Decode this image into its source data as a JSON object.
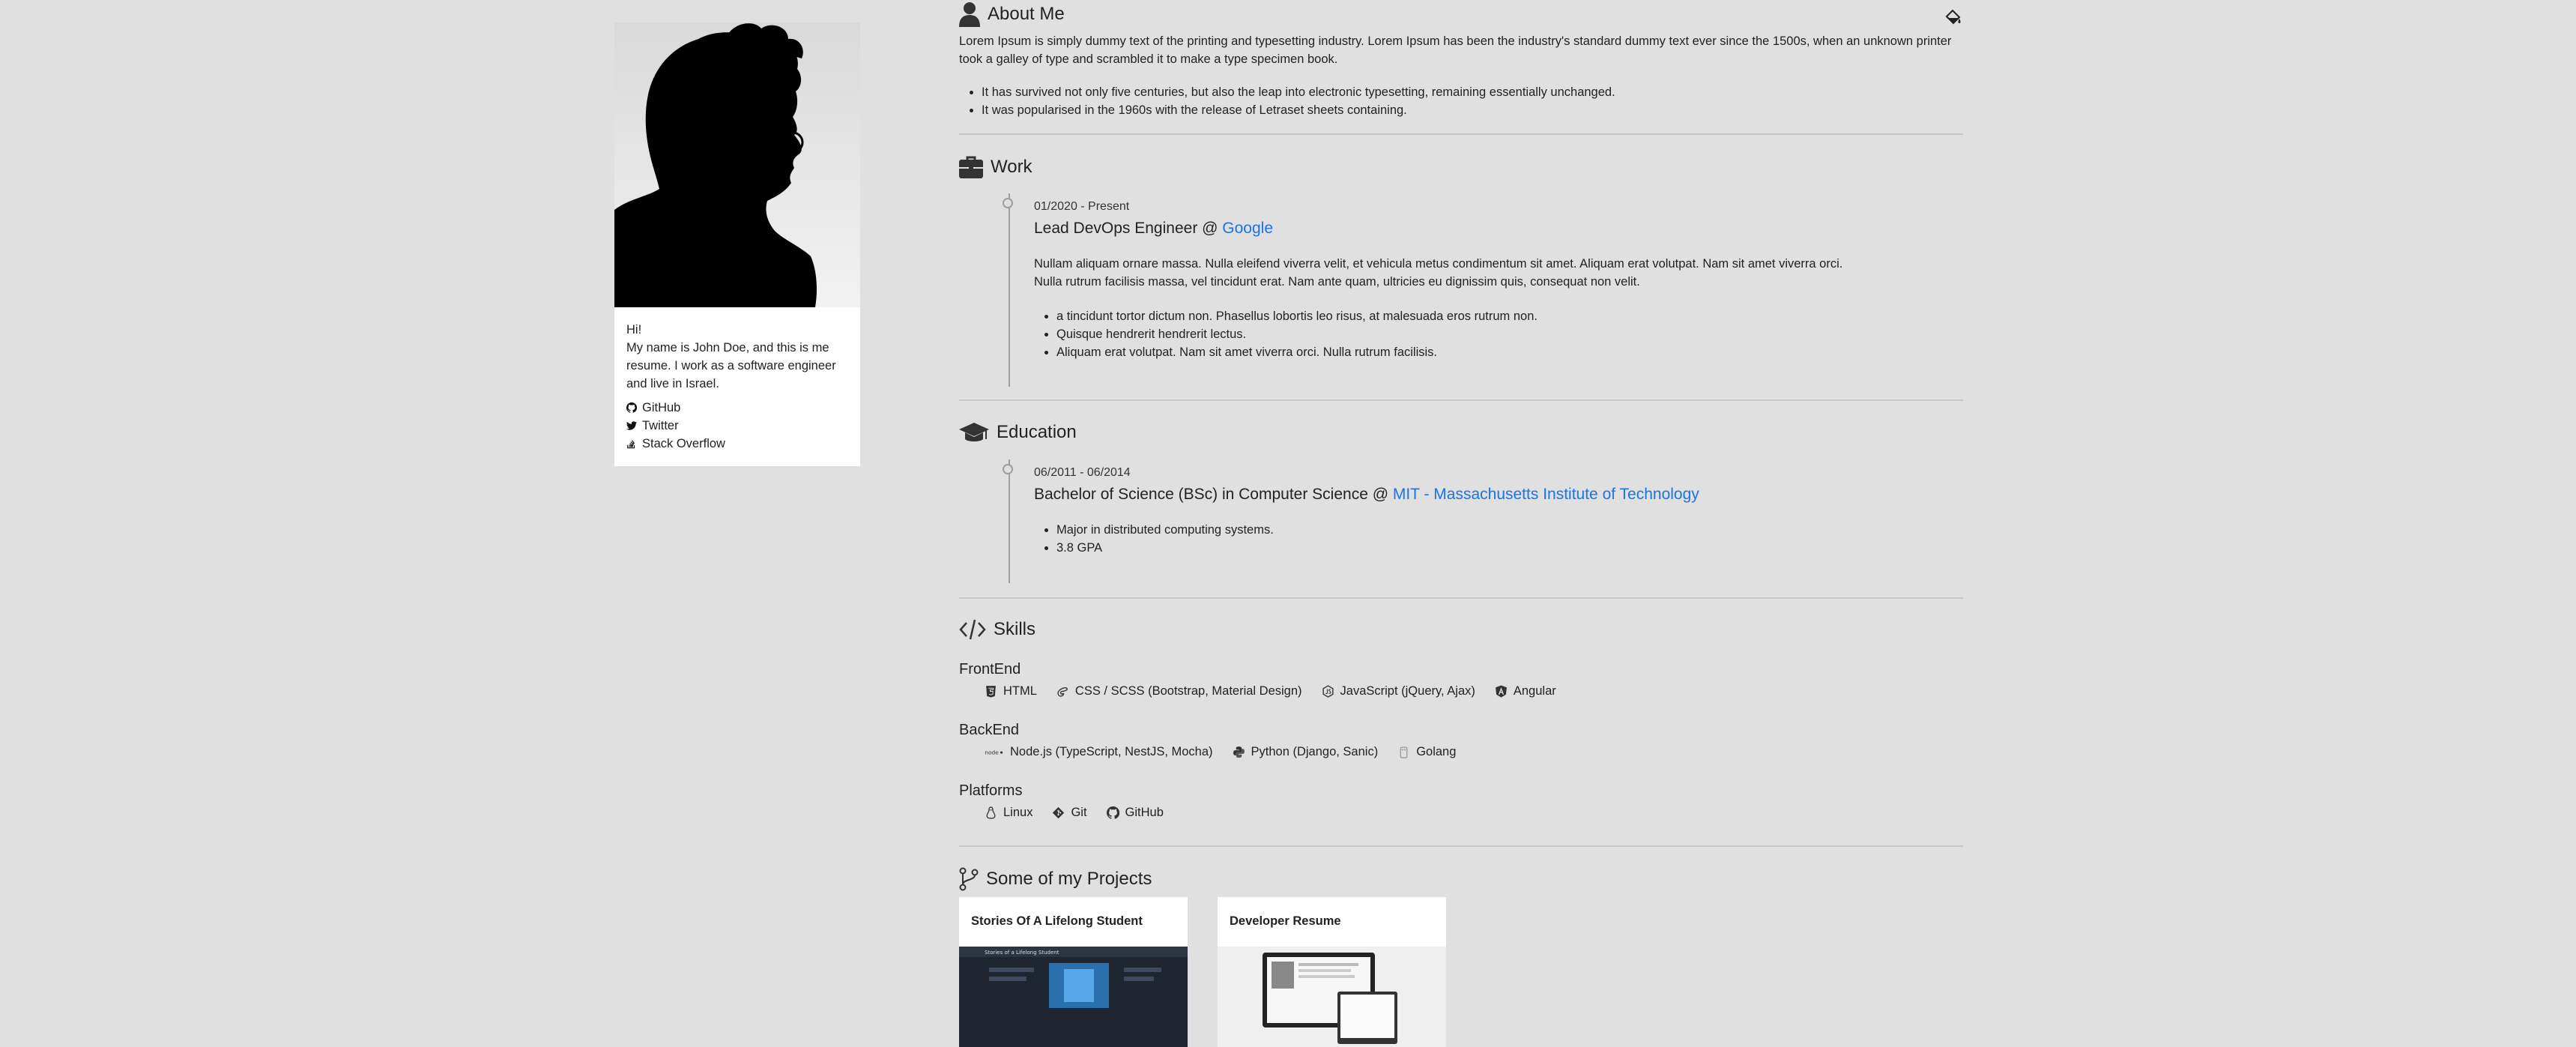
{
  "profile": {
    "greeting": "Hi!",
    "bio": "My name is John Doe, and this is me resume. I work as a software engineer and live in Israel.",
    "links": [
      {
        "label": "GitHub",
        "icon": "github-icon"
      },
      {
        "label": "Twitter",
        "icon": "twitter-icon"
      },
      {
        "label": "Stack Overflow",
        "icon": "stackoverflow-icon"
      }
    ]
  },
  "about": {
    "title": "About Me",
    "paragraph": "Lorem Ipsum is simply dummy text of the printing and typesetting industry. Lorem Ipsum has been the industry's standard dummy text ever since the 1500s, when an unknown printer took a galley of type and scrambled it to make a type specimen book.",
    "bullets": [
      "It has survived not only five centuries, but also the leap into electronic typesetting, remaining essentially unchanged.",
      "It was popularised in the 1960s with the release of Letraset sheets containing."
    ]
  },
  "work": {
    "title": "Work",
    "jobs": [
      {
        "date": "01/2020 - Present",
        "role": "Lead DevOps Engineer @ ",
        "company": "Google",
        "description": "Nullam aliquam ornare massa. Nulla eleifend viverra velit, et vehicula metus condimentum sit amet. Aliquam erat volutpat. Nam sit amet viverra orci. Nulla rutrum facilisis massa, vel tincidunt erat. Nam ante quam, ultricies eu dignissim quis, consequat non velit.",
        "bullets": [
          "a tincidunt tortor dictum non. Phasellus lobortis leo risus, at malesuada eros rutrum non.",
          "Quisque hendrerit hendrerit lectus.",
          "Aliquam erat volutpat. Nam sit amet viverra orci. Nulla rutrum facilisis."
        ]
      }
    ]
  },
  "education": {
    "title": "Education",
    "items": [
      {
        "date": "06/2011 - 06/2014",
        "degree": "Bachelor of Science (BSc) in Computer Science @ ",
        "school": "MIT - Massachusetts Institute of Technology",
        "bullets": [
          "Major in distributed computing systems.",
          "3.8 GPA"
        ]
      }
    ]
  },
  "skills": {
    "title": "Skills",
    "groups": [
      {
        "name": "FrontEnd",
        "items": [
          {
            "label": "HTML",
            "icon": "html5-icon"
          },
          {
            "label": "CSS / SCSS (Bootstrap, Material Design)",
            "icon": "sass-icon"
          },
          {
            "label": "JavaScript (jQuery, Ajax)",
            "icon": "javascript-icon"
          },
          {
            "label": "Angular",
            "icon": "angular-icon"
          }
        ]
      },
      {
        "name": "BackEnd",
        "items": [
          {
            "label": "Node.js (TypeScript, NestJS, Mocha)",
            "icon": "nodejs-icon"
          },
          {
            "label": "Python (Django, Sanic)",
            "icon": "python-icon"
          },
          {
            "label": "Golang",
            "icon": "golang-icon"
          }
        ]
      },
      {
        "name": "Platforms",
        "items": [
          {
            "label": "Linux",
            "icon": "linux-icon"
          },
          {
            "label": "Git",
            "icon": "git-icon"
          },
          {
            "label": "GitHub",
            "icon": "github-icon"
          }
        ]
      }
    ]
  },
  "projects": {
    "title": "Some of my Projects",
    "items": [
      {
        "title": "Stories Of A Lifelong Student",
        "thumb_caption": "Stories of a Lifelong Student"
      },
      {
        "title": "Developer Resume"
      }
    ]
  },
  "colors": {
    "background": "#e0e0e0",
    "link": "#1a73e8",
    "divider": "#c7c7c7"
  }
}
